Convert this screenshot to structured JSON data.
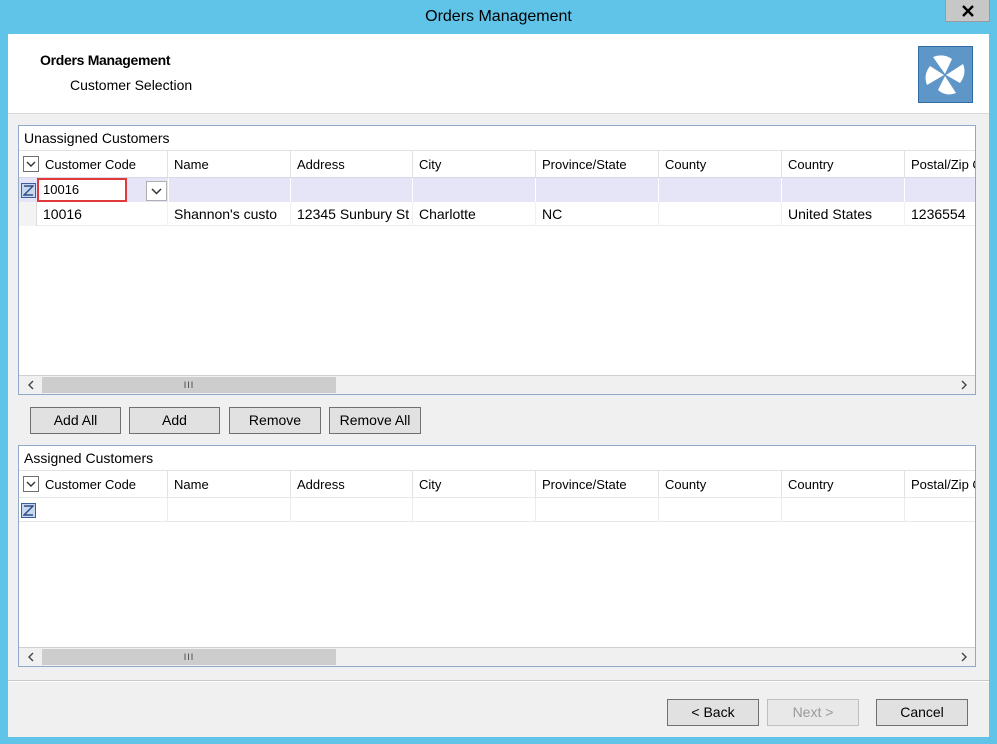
{
  "window": {
    "title": "Orders Management",
    "close_icon": "close-icon"
  },
  "header": {
    "title": "Orders Management",
    "subtitle": "Customer Selection",
    "logo_icon": "pinwheel-logo-icon"
  },
  "columns": [
    "Customer Code",
    "Name",
    "Address",
    "City",
    "Province/State",
    "County",
    "Country",
    "Postal/Zip C"
  ],
  "unassigned": {
    "caption": "Unassigned Customers",
    "filter_value": "10016",
    "rows": [
      {
        "code": "10016",
        "name": "Shannon's custo",
        "address": "12345 Sunbury St",
        "city": "Charlotte",
        "province": "NC",
        "county": "",
        "country": "United States",
        "postal": "1236554"
      }
    ]
  },
  "assigned": {
    "caption": "Assigned Customers",
    "rows": []
  },
  "scrollbar": {
    "thumb_glyph": "III"
  },
  "actions": {
    "add_all": "Add All",
    "add": "Add",
    "remove": "Remove",
    "remove_all": "Remove All"
  },
  "nav": {
    "back": "< Back",
    "next": "Next >",
    "cancel": "Cancel"
  },
  "colors": {
    "titlebar": "#5fc4e8",
    "filter_row": "#e5e5f7",
    "logo": "#5e97c7",
    "highlight": "#e03a3a"
  }
}
